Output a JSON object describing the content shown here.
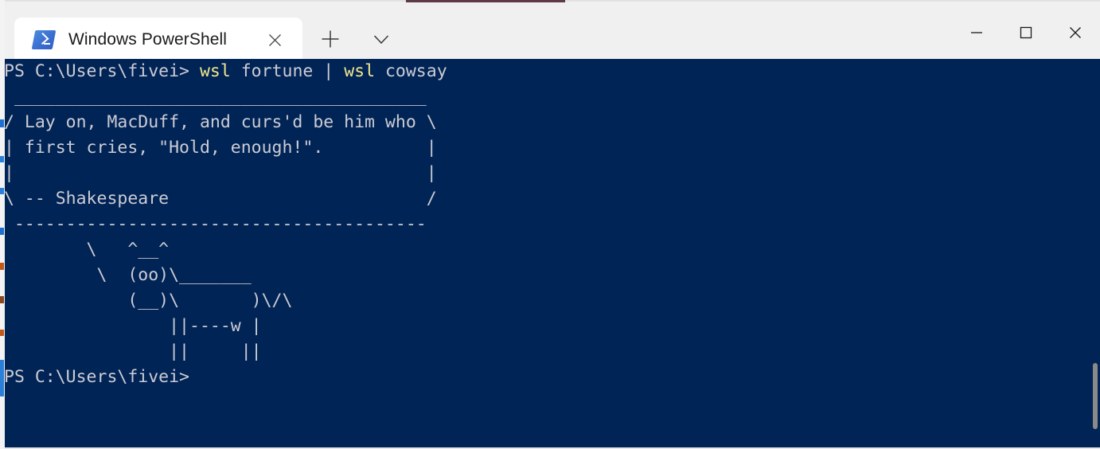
{
  "window": {
    "title": "Windows PowerShell",
    "controls": {
      "minimize_label": "Minimize",
      "maximize_label": "Maximize",
      "close_label": "Close"
    },
    "tabbar": {
      "new_tab_label": "New tab",
      "dropdown_label": "Open a new tab dropdown",
      "tab_close_label": "Close tab"
    }
  },
  "tabs": [
    {
      "label": "Windows PowerShell",
      "icon": "powershell-icon",
      "active": true
    }
  ],
  "terminal": {
    "background_color": "#012456",
    "foreground_color": "#ccccd4",
    "accent_color": "#f0e68c",
    "prompt": "PS C:\\Users\\fivei>",
    "command_prefix": "PS C:\\Users\\fivei> ",
    "command": "wsl fortune | wsl cowsay",
    "command_tokens": [
      {
        "text": "wsl",
        "color": "accent"
      },
      {
        "text": " fortune | ",
        "color": "normal"
      },
      {
        "text": "wsl",
        "color": "accent"
      },
      {
        "text": " cowsay",
        "color": "normal"
      }
    ],
    "final_prompt": "PS C:\\Users\\fivei>",
    "output_lines": [
      " ________________________________________",
      "/ Lay on, MacDuff, and curs'd be him who \\",
      "| first cries, \"Hold, enough!\".          |",
      "|                                        |",
      "\\ -- Shakespeare                         /",
      " ----------------------------------------",
      "        \\   ^__^",
      "         \\  (oo)\\_______",
      "            (__)\\       )\\/\\",
      "                ||----w |",
      "                ||     ||"
    ],
    "quote_text": "Lay on, MacDuff, and curs'd be him who first cries, \"Hold, enough!\".",
    "quote_attribution": "-- Shakespeare",
    "scrollbar": {
      "thumb_top_percent": 78,
      "thumb_height_percent": 17
    }
  }
}
